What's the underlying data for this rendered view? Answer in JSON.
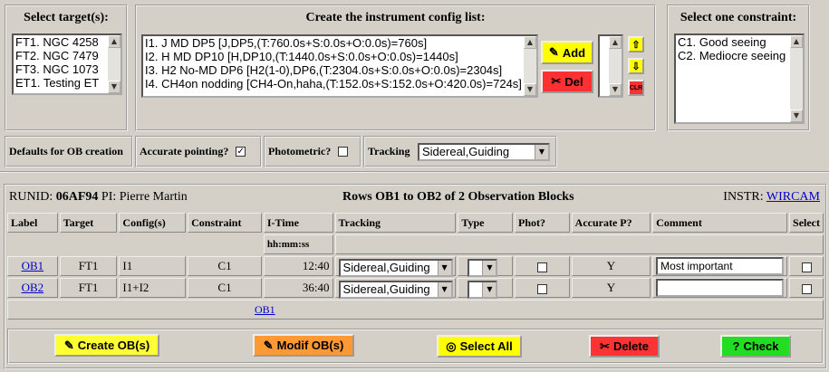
{
  "targets": {
    "title": "Select target(s):",
    "options": [
      "FT1. NGC 4258",
      "FT2. NGC 7479",
      "FT3. NGC 1073",
      "ET1. Testing ET"
    ]
  },
  "configs": {
    "title": "Create the instrument config list:",
    "options": [
      "I1. J MD DP5 [J,DP5,(T:760.0s+S:0.0s+O:0.0s)=760s]",
      "I2. H MD DP10 [H,DP10,(T:1440.0s+S:0.0s+O:0.0s)=1440s]",
      "I3. H2 No-MD DP6 [H2(1-0),DP6,(T:2304.0s+S:0.0s+O:0.0s)=2304s]",
      "I4. CH4on nodding [CH4-On,haha,(T:152.0s+S:152.0s+O:420.0s)=724s]"
    ],
    "add_label": "Add",
    "del_label": "Del",
    "clr_label": "CLR"
  },
  "constraints": {
    "title": "Select one constraint:",
    "options": [
      "C1. Good seeing",
      "C2. Mediocre seeing"
    ]
  },
  "defaults": {
    "title": "Defaults for OB creation",
    "accurate_label": "Accurate pointing?",
    "accurate_checked": "✓",
    "photometric_label": "Photometric?",
    "tracking_label": "Tracking",
    "tracking_value": "Sidereal,Guiding"
  },
  "header": {
    "runid_label": "RUNID:",
    "runid": "06AF94",
    "pi_label": "PI:",
    "pi": "Pierre Martin",
    "rows_info": "Rows OB1 to OB2 of 2 Observation Blocks",
    "instr_label": "INSTR:",
    "instr": "WIRCAM"
  },
  "table": {
    "columns": [
      "Label",
      "Target",
      "Config(s)",
      "Constraint",
      "I-Time",
      "Tracking",
      "Type",
      "Phot?",
      "Accurate P?",
      "Comment",
      "Select"
    ],
    "itime_unit": "hh:mm:ss",
    "rows": [
      {
        "label": "OB1",
        "target": "FT1",
        "config": "I1",
        "constraint": "C1",
        "itime": "12:40",
        "tracking": "Sidereal,Guiding",
        "accurate": "Y",
        "comment": "Most important"
      },
      {
        "label": "OB2",
        "target": "FT1",
        "config": "I1+I2",
        "constraint": "C1",
        "itime": "36:40",
        "tracking": "Sidereal,Guiding",
        "accurate": "Y",
        "comment": ""
      }
    ],
    "footer_link": "OB1"
  },
  "actions": {
    "create": "Create OB(s)",
    "modif": "Modif OB(s)",
    "select_all": "Select All",
    "delete": "Delete",
    "check": "Check"
  },
  "colors": {
    "add": "#ffff00",
    "del": "#ff3030",
    "create": "#ffff33",
    "modif": "#ff9933",
    "select_all": "#ffff00",
    "delete": "#ff3333",
    "check": "#22dd22"
  }
}
